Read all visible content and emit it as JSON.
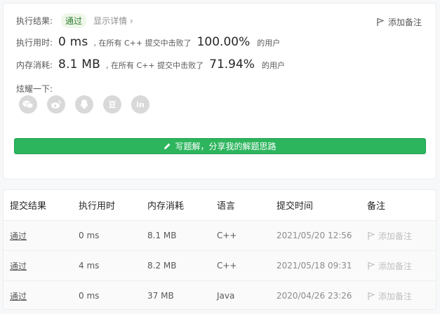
{
  "result": {
    "label": "执行结果:",
    "status": "通过",
    "detail_link": "显示详情 ›",
    "add_note": "添加备注"
  },
  "runtime": {
    "label": "执行用时:",
    "value": "0 ms",
    "prefix": ", 在所有 C++ 提交中击败了",
    "percent": "100.00%",
    "suffix": "的用户"
  },
  "memory": {
    "label": "内存消耗:",
    "value": "8.1 MB",
    "prefix": ", 在所有 C++ 提交中击败了",
    "percent": "71.94%",
    "suffix": "的用户"
  },
  "share": {
    "label": "炫耀一下:",
    "icons": [
      "wechat-icon",
      "weibo-icon",
      "qq-icon",
      "douban-icon",
      "linkedin-icon"
    ],
    "douban_glyph": "豆",
    "linkedin_glyph": "in"
  },
  "write_button": "写题解，分享我的解题思路",
  "table": {
    "headers": {
      "status": "提交结果",
      "time": "执行用时",
      "memory": "内存消耗",
      "language": "语言",
      "submitted": "提交时间",
      "note": "备注"
    },
    "rows": [
      {
        "status": "通过",
        "time": "0 ms",
        "memory": "8.1 MB",
        "language": "C++",
        "submitted": "2021/05/20 12:56",
        "note": "添加备注"
      },
      {
        "status": "通过",
        "time": "4 ms",
        "memory": "8.2 MB",
        "language": "C++",
        "submitted": "2021/05/18 09:31",
        "note": "添加备注"
      },
      {
        "status": "通过",
        "time": "0 ms",
        "memory": "37 MB",
        "language": "Java",
        "submitted": "2020/04/26 23:26",
        "note": "添加备注"
      }
    ]
  },
  "colors": {
    "accent_green": "#2db55d",
    "pass_pill_bg": "#eef7e8",
    "muted": "#8c8c8c"
  }
}
